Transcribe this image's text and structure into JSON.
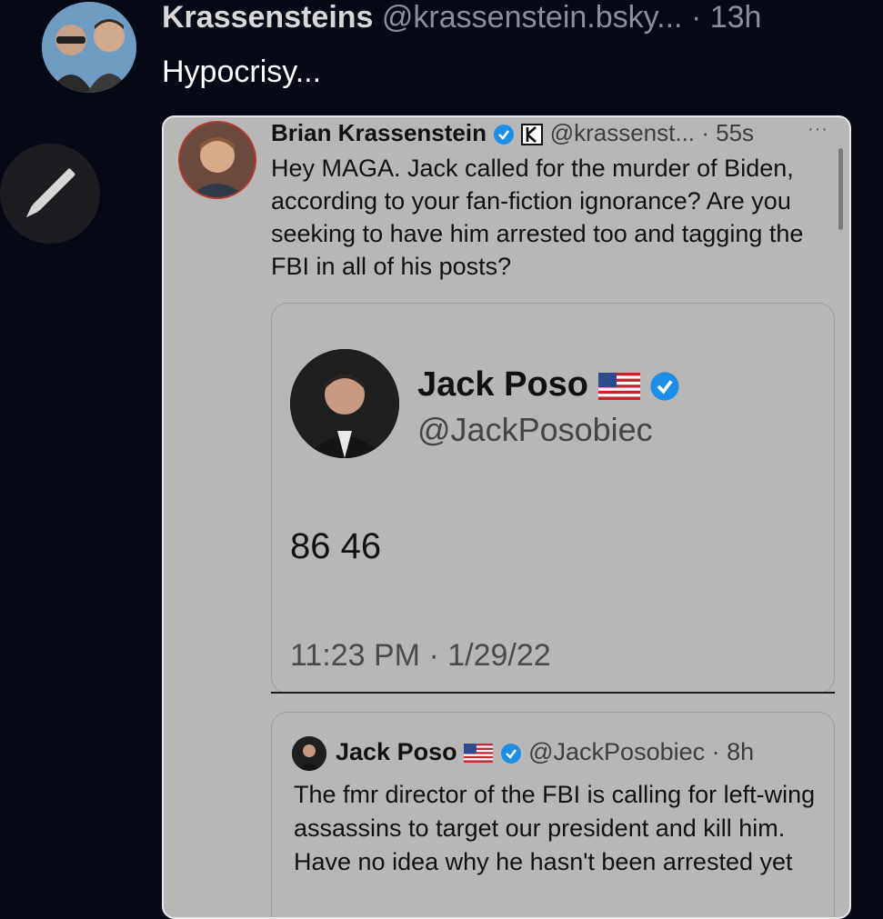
{
  "post": {
    "author_name": "Krassensteins",
    "author_handle": "@krassenstein.bsky...",
    "time": "· 13h",
    "text": "Hypocrisy..."
  },
  "screenshot": {
    "author_name": "Brian Krassenstein",
    "handle_time": "@krassenst... · 55s",
    "more": "···",
    "text": "Hey MAGA. Jack called for the murder of Biden, according to your fan-fiction ignorance?  Are you seeking to have him arrested too and tagging the FBI in all of his posts?",
    "quoted_card": {
      "name": "Jack Poso",
      "handle": "@JackPosobiec",
      "text": "86 46",
      "timestamp": "11:23 PM · 1/29/22"
    },
    "quoted_post": {
      "name": "Jack Poso",
      "handle_time": "@JackPosobiec · 8h",
      "text": "The fmr director of the FBI is calling for left-wing assassins to target our president and kill him. Have no idea why he hasn't been arrested yet"
    }
  },
  "colors": {
    "background": "#050815",
    "screenshot_bg": "#b7b7b7",
    "verified": "#1d8de6"
  },
  "icons": [
    "avatar",
    "pencil-icon",
    "verified-badge-icon",
    "k-badge-icon",
    "us-flag-icon",
    "more-icon"
  ]
}
